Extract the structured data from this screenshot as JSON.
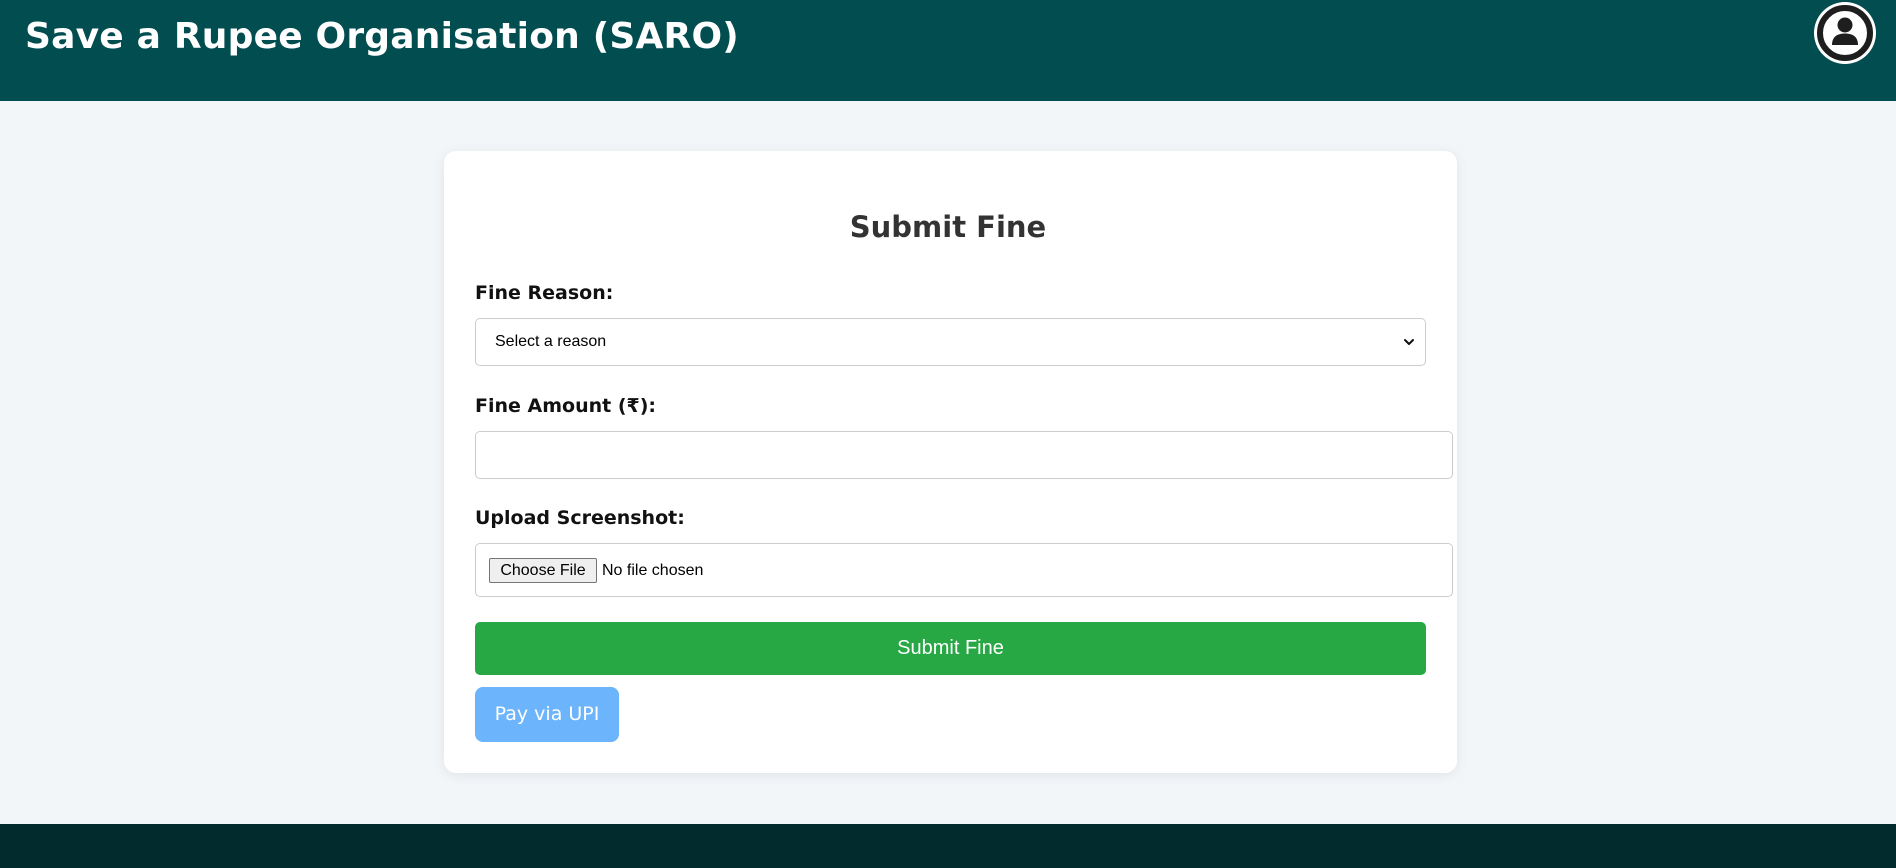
{
  "header": {
    "title": "Save a Rupee Organisation (SARO)",
    "profile_icon": "user-circle-icon"
  },
  "form": {
    "title": "Submit Fine",
    "reason": {
      "label": "Fine Reason:",
      "selected": "Select a reason"
    },
    "amount": {
      "label": "Fine Amount (₹):",
      "value": "",
      "placeholder": ""
    },
    "screenshot": {
      "label": "Upload Screenshot:",
      "button_label": "Choose File",
      "status": "No file chosen"
    },
    "submit_label": "Submit Fine",
    "upi_label": "Pay via UPI"
  },
  "colors": {
    "header_bg": "#024d50",
    "footer_bg": "#022b2d",
    "submit_bg": "#28a745",
    "upi_bg": "#6cb4fb",
    "page_bg": "#f2f6f9"
  }
}
